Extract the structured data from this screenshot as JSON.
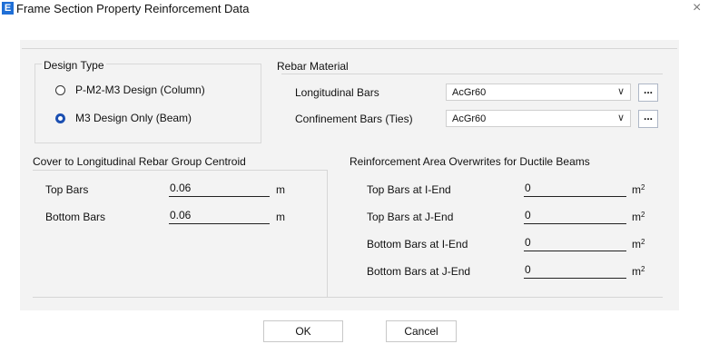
{
  "window": {
    "title": "Frame Section Property Reinforcement Data",
    "icon_letter": "E",
    "close_glyph": "×"
  },
  "design_type": {
    "label": "Design Type",
    "options": [
      {
        "label": "P-M2-M3 Design  (Column)",
        "selected": false
      },
      {
        "label": "M3 Design Only  (Beam)",
        "selected": true
      }
    ]
  },
  "rebar_material": {
    "label": "Rebar Material",
    "longitudinal": {
      "label": "Longitudinal Bars",
      "value": "AcGr60"
    },
    "confinement": {
      "label": "Confinement Bars (Ties)",
      "value": "AcGr60"
    },
    "more_label": "..."
  },
  "cover": {
    "label": "Cover to Longitudinal Rebar Group Centroid",
    "rows": [
      {
        "label": "Top Bars",
        "value": "0.06",
        "unit": "m"
      },
      {
        "label": "Bottom  Bars",
        "value": "0.06",
        "unit": "m"
      }
    ]
  },
  "overwrites": {
    "label": "Reinforcement Area Overwrites for Ductile Beams",
    "rows": [
      {
        "label": "Top Bars at I-End",
        "value": "0",
        "unit": "m²"
      },
      {
        "label": "Top Bars at J-End",
        "value": "0",
        "unit": "m²"
      },
      {
        "label": "Bottom Bars at I-End",
        "value": "0",
        "unit": "m²"
      },
      {
        "label": "Bottom Bars at J-End",
        "value": "0",
        "unit": "m²"
      }
    ]
  },
  "buttons": {
    "ok": "OK",
    "cancel": "Cancel"
  }
}
